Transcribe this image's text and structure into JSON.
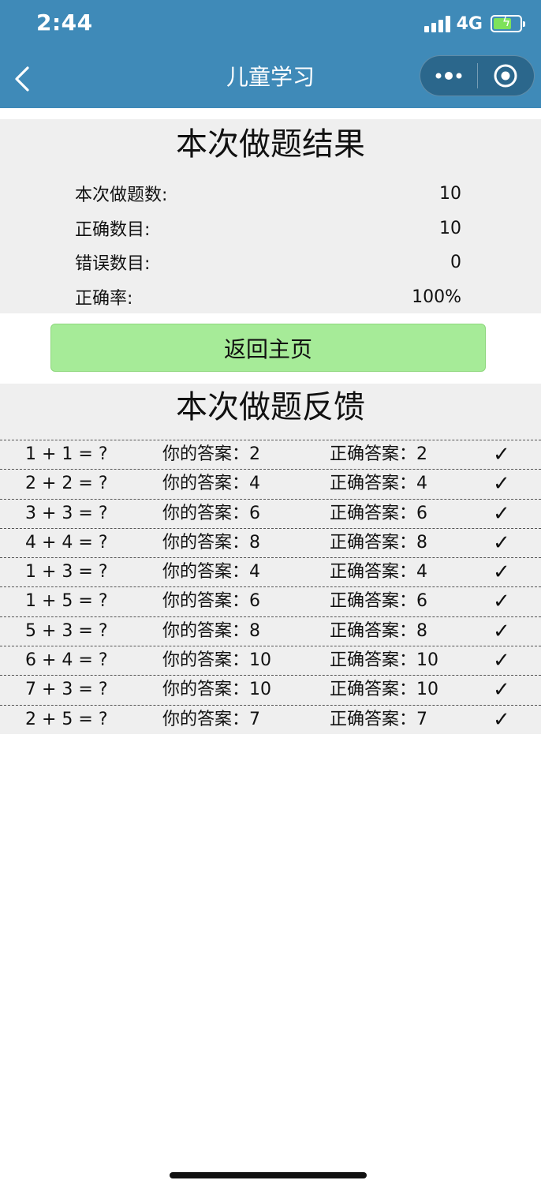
{
  "status_bar": {
    "time": "2:44",
    "network": "4G"
  },
  "nav": {
    "title": "儿童学习"
  },
  "result": {
    "title": "本次做题结果",
    "stats": [
      {
        "label": "本次做题数:",
        "value": "10"
      },
      {
        "label": "正确数目:",
        "value": "10"
      },
      {
        "label": "错误数目:",
        "value": "0"
      },
      {
        "label": "正确率:",
        "value": "100%"
      }
    ]
  },
  "home_button": {
    "label": "返回主页"
  },
  "feedback": {
    "title": "本次做题反馈",
    "rows": [
      {
        "question": "1 + 1 = ?",
        "your_answer": "你的答案：2",
        "correct_answer": "正确答案：2",
        "mark": "✓"
      },
      {
        "question": "2 + 2 = ?",
        "your_answer": "你的答案：4",
        "correct_answer": "正确答案：4",
        "mark": "✓"
      },
      {
        "question": "3 + 3 = ?",
        "your_answer": "你的答案：6",
        "correct_answer": "正确答案：6",
        "mark": "✓"
      },
      {
        "question": "4 + 4 = ?",
        "your_answer": "你的答案：8",
        "correct_answer": "正确答案：8",
        "mark": "✓"
      },
      {
        "question": "1 + 3 = ?",
        "your_answer": "你的答案：4",
        "correct_answer": "正确答案：4",
        "mark": "✓"
      },
      {
        "question": "1 + 5 = ?",
        "your_answer": "你的答案：6",
        "correct_answer": "正确答案：6",
        "mark": "✓"
      },
      {
        "question": "5 + 3 = ?",
        "your_answer": "你的答案：8",
        "correct_answer": "正确答案：8",
        "mark": "✓"
      },
      {
        "question": "6 + 4 = ?",
        "your_answer": "你的答案：10",
        "correct_answer": "正确答案：10",
        "mark": "✓"
      },
      {
        "question": "7 + 3 = ?",
        "your_answer": "你的答案：10",
        "correct_answer": "正确答案：10",
        "mark": "✓"
      },
      {
        "question": "2 + 5 = ?",
        "your_answer": "你的答案：7",
        "correct_answer": "正确答案：7",
        "mark": "✓"
      }
    ]
  },
  "icons": {
    "back": "chevron-left-icon",
    "more": "more-dots-icon",
    "close": "target-close-icon",
    "signal": "signal-bars-icon",
    "battery": "battery-charging-icon"
  },
  "colors": {
    "header_bg": "#3f8ab8",
    "panel_bg": "#efefef",
    "button_bg": "#a6eb98",
    "battery_fill": "#7ee25a"
  }
}
